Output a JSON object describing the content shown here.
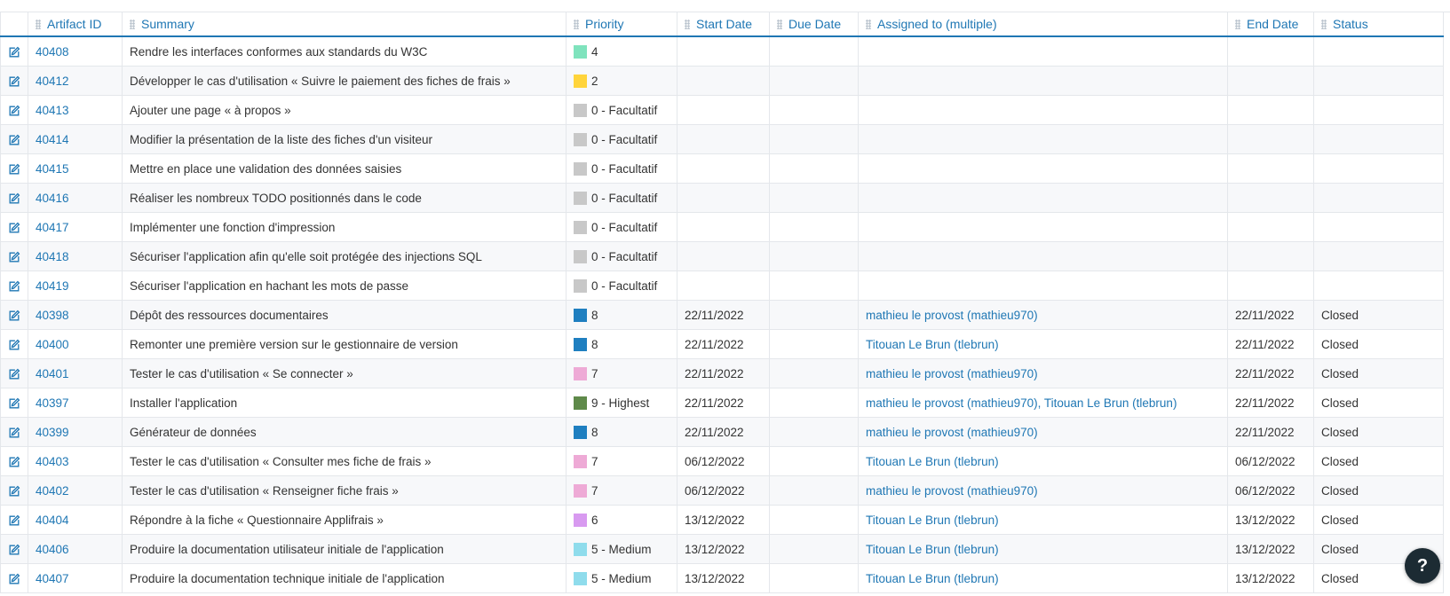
{
  "colors": {
    "link": "#1f77b4",
    "border": "#e4e7eb",
    "row_alt": "#f7f8fa",
    "help_bg": "#1c2b33"
  },
  "table": {
    "columns": [
      {
        "key": "edit",
        "label": ""
      },
      {
        "key": "id",
        "label": "Artifact ID"
      },
      {
        "key": "summary",
        "label": "Summary"
      },
      {
        "key": "priority",
        "label": "Priority"
      },
      {
        "key": "start",
        "label": "Start Date"
      },
      {
        "key": "due",
        "label": "Due Date"
      },
      {
        "key": "assigned",
        "label": "Assigned to (multiple)"
      },
      {
        "key": "end",
        "label": "End Date"
      },
      {
        "key": "status",
        "label": "Status"
      }
    ],
    "rows": [
      {
        "id": "40408",
        "summary": "Rendre les interfaces conformes aux standards du W3C",
        "priority": "4",
        "priority_color": "#7fe3bd",
        "start": "",
        "due": "",
        "assigned": "",
        "end": "",
        "status": ""
      },
      {
        "id": "40412",
        "summary": "Développer le cas d'utilisation « Suivre le paiement des fiches de frais »",
        "priority": "2",
        "priority_color": "#ffd43b",
        "start": "",
        "due": "",
        "assigned": "",
        "end": "",
        "status": ""
      },
      {
        "id": "40413",
        "summary": "Ajouter une page « à propos »",
        "priority": "0 - Facultatif",
        "priority_color": "#c8c8c8",
        "start": "",
        "due": "",
        "assigned": "",
        "end": "",
        "status": ""
      },
      {
        "id": "40414",
        "summary": "Modifier la présentation de la liste des fiches d'un visiteur",
        "priority": "0 - Facultatif",
        "priority_color": "#c8c8c8",
        "start": "",
        "due": "",
        "assigned": "",
        "end": "",
        "status": ""
      },
      {
        "id": "40415",
        "summary": "Mettre en place une validation des données saisies",
        "priority": "0 - Facultatif",
        "priority_color": "#c8c8c8",
        "start": "",
        "due": "",
        "assigned": "",
        "end": "",
        "status": ""
      },
      {
        "id": "40416",
        "summary": "Réaliser les nombreux TODO positionnés dans le code",
        "priority": "0 - Facultatif",
        "priority_color": "#c8c8c8",
        "start": "",
        "due": "",
        "assigned": "",
        "end": "",
        "status": ""
      },
      {
        "id": "40417",
        "summary": "Implémenter une fonction d'impression",
        "priority": "0 - Facultatif",
        "priority_color": "#c8c8c8",
        "start": "",
        "due": "",
        "assigned": "",
        "end": "",
        "status": ""
      },
      {
        "id": "40418",
        "summary": "Sécuriser l'application afin qu'elle soit protégée des injections SQL",
        "priority": "0 - Facultatif",
        "priority_color": "#c8c8c8",
        "start": "",
        "due": "",
        "assigned": "",
        "end": "",
        "status": ""
      },
      {
        "id": "40419",
        "summary": "Sécuriser l'application en hachant les mots de passe",
        "priority": "0 - Facultatif",
        "priority_color": "#c8c8c8",
        "start": "",
        "due": "",
        "assigned": "",
        "end": "",
        "status": ""
      },
      {
        "id": "40398",
        "summary": "Dépôt des ressources documentaires",
        "priority": "8",
        "priority_color": "#1f7fc0",
        "start": "22/11/2022",
        "due": "",
        "assigned": "mathieu le provost (mathieu970)",
        "end": "22/11/2022",
        "status": "Closed"
      },
      {
        "id": "40400",
        "summary": "Remonter une première version sur le gestionnaire de version",
        "priority": "8",
        "priority_color": "#1f7fc0",
        "start": "22/11/2022",
        "due": "",
        "assigned": "Titouan Le Brun (tlebrun)",
        "end": "22/11/2022",
        "status": "Closed"
      },
      {
        "id": "40401",
        "summary": "Tester le cas d'utilisation « Se connecter »",
        "priority": "7",
        "priority_color": "#eeaad6",
        "start": "22/11/2022",
        "due": "",
        "assigned": "mathieu le provost (mathieu970)",
        "end": "22/11/2022",
        "status": "Closed"
      },
      {
        "id": "40397",
        "summary": "Installer l'application",
        "priority": "9 - Highest",
        "priority_color": "#5f8a4a",
        "start": "22/11/2022",
        "due": "",
        "assigned": "mathieu le provost (mathieu970), Titouan Le Brun (tlebrun)",
        "end": "22/11/2022",
        "status": "Closed"
      },
      {
        "id": "40399",
        "summary": "Générateur de données",
        "priority": "8",
        "priority_color": "#1f7fc0",
        "start": "22/11/2022",
        "due": "",
        "assigned": "mathieu le provost (mathieu970)",
        "end": "22/11/2022",
        "status": "Closed"
      },
      {
        "id": "40403",
        "summary": "Tester le cas d'utilisation « Consulter mes fiche de frais »",
        "priority": "7",
        "priority_color": "#eeaad6",
        "start": "06/12/2022",
        "due": "",
        "assigned": "Titouan Le Brun (tlebrun)",
        "end": "06/12/2022",
        "status": "Closed"
      },
      {
        "id": "40402",
        "summary": "Tester le cas d'utilisation « Renseigner fiche frais »",
        "priority": "7",
        "priority_color": "#eeaad6",
        "start": "06/12/2022",
        "due": "",
        "assigned": "mathieu le provost (mathieu970)",
        "end": "06/12/2022",
        "status": "Closed"
      },
      {
        "id": "40404",
        "summary": "Répondre à la fiche « Questionnaire Applifrais »",
        "priority": "6",
        "priority_color": "#d89af0",
        "start": "13/12/2022",
        "due": "",
        "assigned": "Titouan Le Brun (tlebrun)",
        "end": "13/12/2022",
        "status": "Closed"
      },
      {
        "id": "40406",
        "summary": "Produire la documentation utilisateur initiale de l'application",
        "priority": "5 - Medium",
        "priority_color": "#8fdcec",
        "start": "13/12/2022",
        "due": "",
        "assigned": "Titouan Le Brun (tlebrun)",
        "end": "13/12/2022",
        "status": "Closed"
      },
      {
        "id": "40407",
        "summary": "Produire la documentation technique initiale de l'application",
        "priority": "5 - Medium",
        "priority_color": "#8fdcec",
        "start": "13/12/2022",
        "due": "",
        "assigned": "Titouan Le Brun (tlebrun)",
        "end": "13/12/2022",
        "status": "Closed"
      }
    ]
  },
  "help_button": {
    "label": "?",
    "icon": "question-icon"
  }
}
